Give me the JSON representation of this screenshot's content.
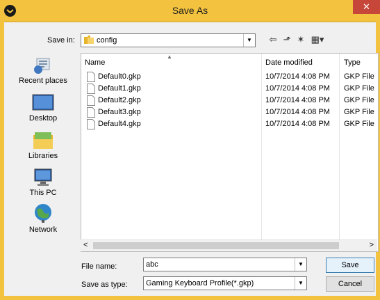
{
  "window": {
    "title": "Save As",
    "close_glyph": "✕"
  },
  "toolbar": {
    "save_in_label": "Save in:",
    "save_in_value": "config",
    "dropdown_glyph": "▼",
    "back_glyph": "⇦",
    "up_glyph": "⬏",
    "new_folder_glyph": "✶",
    "view_glyph": "▦▾"
  },
  "places": [
    {
      "label": "Recent places",
      "icon": "recent-places-icon"
    },
    {
      "label": "Desktop",
      "icon": "desktop-icon"
    },
    {
      "label": "Libraries",
      "icon": "libraries-icon"
    },
    {
      "label": "This PC",
      "icon": "this-pc-icon"
    },
    {
      "label": "Network",
      "icon": "network-icon"
    }
  ],
  "columns": {
    "name": "Name",
    "date": "Date modified",
    "type": "Type"
  },
  "files": [
    {
      "name": "Default0.gkp",
      "date": "10/7/2014 4:08 PM",
      "type": "GKP File"
    },
    {
      "name": "Default1.gkp",
      "date": "10/7/2014 4:08 PM",
      "type": "GKP File"
    },
    {
      "name": "Default2.gkp",
      "date": "10/7/2014 4:08 PM",
      "type": "GKP File"
    },
    {
      "name": "Default3.gkp",
      "date": "10/7/2014 4:08 PM",
      "type": "GKP File"
    },
    {
      "name": "Default4.gkp",
      "date": "10/7/2014 4:08 PM",
      "type": "GKP File"
    }
  ],
  "scrollbar": {
    "left_glyph": "<",
    "right_glyph": ">"
  },
  "form": {
    "file_name_label": "File name:",
    "file_name_value": "abc",
    "save_type_label": "Save as type:",
    "save_type_value": "Gaming Keyboard Profile(*.gkp)"
  },
  "buttons": {
    "save": "Save",
    "cancel": "Cancel"
  },
  "colors": {
    "title_bar": "#f3c33f",
    "close_button": "#c7463a",
    "folder": "#e8b42a"
  }
}
